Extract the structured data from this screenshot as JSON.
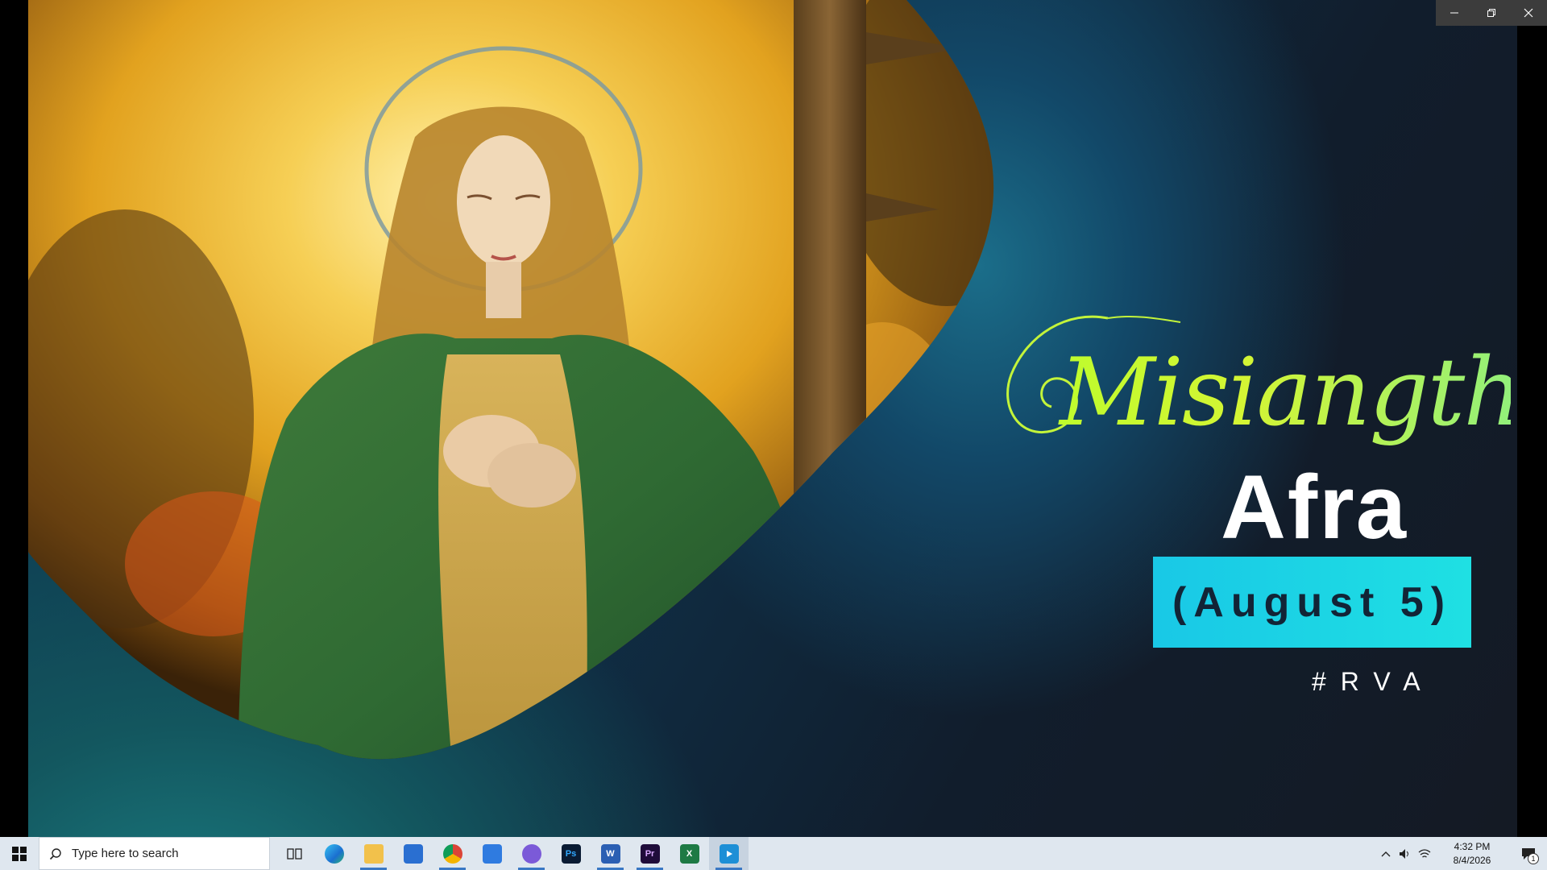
{
  "slide": {
    "script_title": "Misiangtho",
    "name": "Afra",
    "date": "(August 5)",
    "hashtag": "#RVA"
  },
  "window_controls": {
    "minimize": "minimize-icon",
    "restore": "restore-icon",
    "close": "close-icon"
  },
  "taskbar": {
    "search_placeholder": "Type here to search",
    "apps": [
      {
        "name": "Task View",
        "icon": "task-view-icon"
      },
      {
        "name": "Microsoft Edge",
        "icon": "edge-icon"
      },
      {
        "name": "File Explorer",
        "icon": "folder-icon"
      },
      {
        "name": "Microsoft Store",
        "icon": "store-icon"
      },
      {
        "name": "Google Chrome",
        "icon": "chrome-icon"
      },
      {
        "name": "Mail",
        "icon": "mail-icon"
      },
      {
        "name": "Viber",
        "icon": "viber-icon"
      },
      {
        "name": "Photoshop",
        "icon_text": "Ps"
      },
      {
        "name": "Word",
        "icon_text": "W"
      },
      {
        "name": "Premiere Pro",
        "icon_text": "Pr"
      },
      {
        "name": "Excel",
        "icon_text": "X"
      },
      {
        "name": "Video Player",
        "icon": "play-icon"
      }
    ],
    "clock_time": "4:32 PM",
    "clock_date": "8/4/2026",
    "notification_count": "1"
  },
  "colors": {
    "script_title": "#c6f52e",
    "date_box": "#1fd6e6",
    "slide_bg": "#0f2b40"
  }
}
